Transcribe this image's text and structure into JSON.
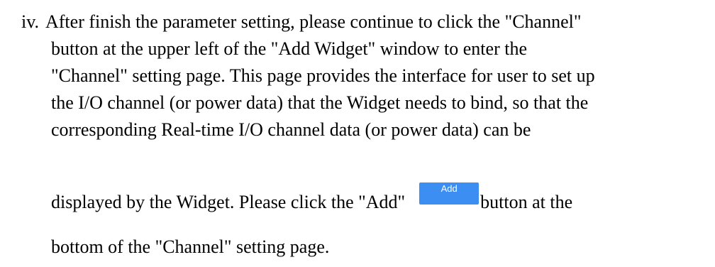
{
  "list_marker": "iv.",
  "lines": {
    "l1": "After finish the parameter setting, please continue to click the \"Channel\"",
    "l2": "button at the upper left of the \"Add Widget\" window to enter the",
    "l3": "\"Channel\" setting page. This page provides the interface for user to set up",
    "l4": "the I/O channel (or power data) that the Widget needs to bind, so that the",
    "l5": "corresponding Real-time I/O channel data (or power data) can be",
    "l7_before": "displayed by the Widget. Please click the \"Add\"",
    "l7_after": "button at the",
    "l8": "bottom of the \"Channel\" setting page."
  },
  "add_button": {
    "label": "Add",
    "color": "#3d8ef2"
  }
}
